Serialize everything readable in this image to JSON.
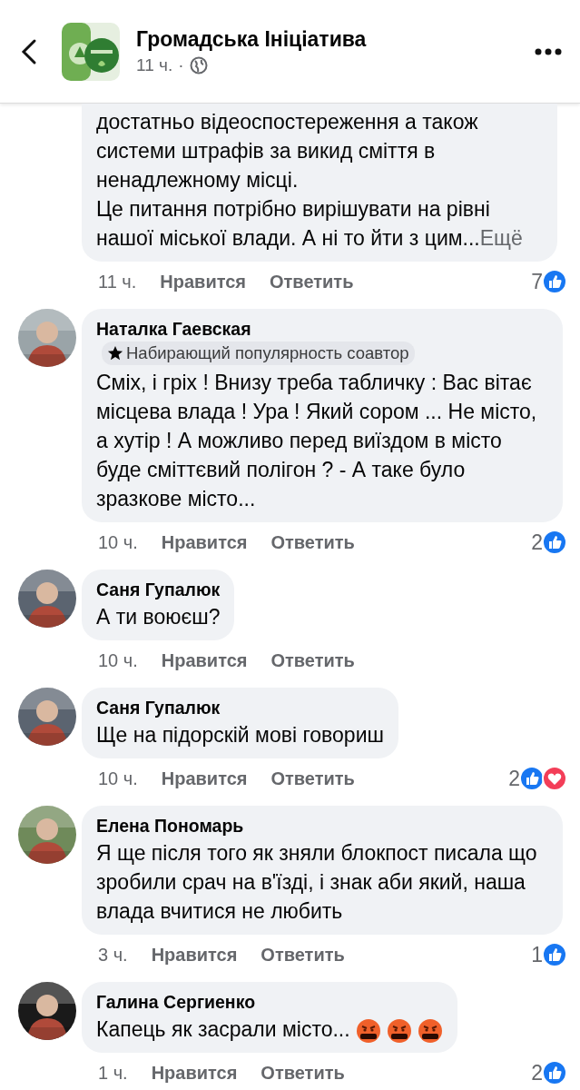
{
  "header": {
    "page_name": "Громадська Ініціатива",
    "time": "11 ч.",
    "separator": "·"
  },
  "comments": [
    {
      "text": "достатньо відеоспостереження а також\nсистеми штрафів за викид сміття в\nненадлежному місці.\nЦе питання потрібно вирішувати на рівні\nнашої міської влади. А ні то йти з цим...",
      "more": "Ещё",
      "time": "11 ч.",
      "like": "Нравится",
      "reply": "Ответить",
      "reaction_count": "7",
      "reactions": [
        {
          "kind": "like"
        }
      ]
    },
    {
      "author": "Наталка Гаевская",
      "badge": "Набирающий популярность соавтор",
      "avatar": {
        "kind": "picture"
      },
      "text": "Сміх, і гріх ! Внизу треба табличку : Вас вітає місцева влада ! Ура ! Який сором ... Не місто, а хутір ! А можливо перед виїздом в місто буде сміттєвий полігон ? - А таке було зразкове місто...",
      "time": "10 ч.",
      "like": "Нравится",
      "reply": "Ответить",
      "reaction_count": "2",
      "reactions": [
        {
          "kind": "like"
        }
      ]
    },
    {
      "author": "Саня Гупалюк",
      "avatar": {
        "kind": "picture"
      },
      "text": "А ти воюєш?",
      "time": "10 ч.",
      "like": "Нравится",
      "reply": "Ответить"
    },
    {
      "author": "Саня Гупалюк",
      "avatar": {
        "kind": "picture"
      },
      "text": "Ще на підорскій мові говориш",
      "time": "10 ч.",
      "like": "Нравится",
      "reply": "Ответить",
      "reaction_count": "2",
      "reactions": [
        {
          "kind": "like"
        },
        {
          "kind": "love"
        }
      ]
    },
    {
      "author": "Елена Пономарь",
      "avatar": {
        "kind": "picture"
      },
      "text": "Я ще після того як зняли блокпост писала що зробили срач на в'їзді, і знак аби який, наша влада вчитися не любить",
      "time": "3 ч.",
      "like": "Нравится",
      "reply": "Ответить",
      "reaction_count": "1",
      "reactions": [
        {
          "kind": "like"
        }
      ]
    },
    {
      "author": "Галина Сергиенко",
      "avatar": {
        "kind": "picture"
      },
      "text": "Капець як засрали місто...",
      "emojis": [
        {
          "kind": "cursing-face"
        },
        {
          "kind": "cursing-face"
        },
        {
          "kind": "cursing-face"
        }
      ],
      "time": "1 ч.",
      "like": "Нравится",
      "reply": "Ответить",
      "reaction_count": "2",
      "reactions": [
        {
          "kind": "like"
        }
      ]
    }
  ]
}
